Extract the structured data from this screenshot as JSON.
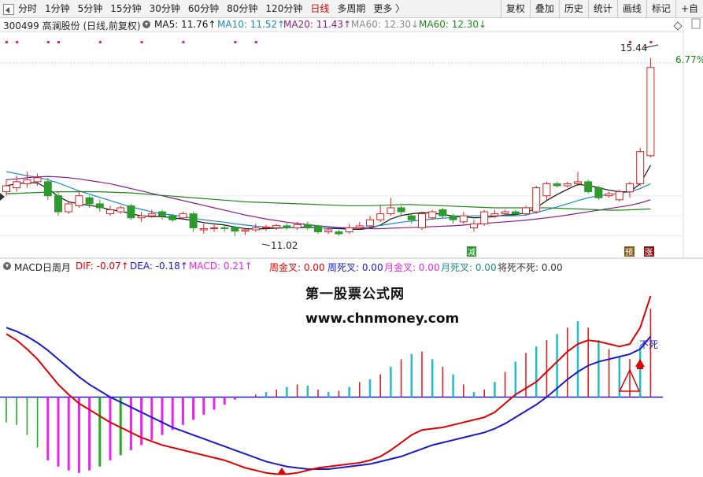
{
  "toolbar": {
    "tabs": [
      "分时",
      "1分钟",
      "5分钟",
      "15分钟",
      "30分钟",
      "60分钟",
      "80分钟",
      "120分钟",
      "日线",
      "多周期",
      "更多 〉"
    ],
    "active_tab": "日线",
    "right_buttons": [
      "复权",
      "叠加",
      "历史",
      "统计",
      "画线",
      "标记",
      "+自"
    ]
  },
  "info": {
    "code_name": "300499  高澜股份 (日线,前复权)",
    "ma5": "MA5: 11.76↑",
    "ma10": "MA10: 11.52↑",
    "ma20": "MA20: 11.43↑",
    "ma60a": "MA60: 12.30↓",
    "ma60b": "MA60: 12.30↓"
  },
  "macd_info": {
    "title": "MACD日周月",
    "dif": "DIF: -0.07↑",
    "dea": "DEA: -0.18↑",
    "macd": "MACD: 0.21↑",
    "zhou_jin": "周金叉: 0.00",
    "zhou_si": "周死叉: 0.00",
    "yue_jin": "月金叉: 0.00",
    "yue_si": "月死叉: 0.00",
    "jiang_si": "将死不死: 0.00"
  },
  "annotations": {
    "high": "15.44",
    "low": "11.02",
    "pct": "6.77%",
    "bu_si": "不死",
    "mark_jian": "减",
    "mark_yu": "预",
    "mark_zhang": "涨"
  },
  "watermark": {
    "line1": "第一股票公式网",
    "line2": "www.chnmoney.com"
  },
  "colors": {
    "up": "#e02020",
    "down": "#2e9a2e",
    "dif": "#e00000",
    "dea": "#1a1acc",
    "ma5": "#111111",
    "ma10": "#1a88d0",
    "ma20": "#8a1a8a",
    "ma60": "#1a8a1a",
    "hist_magenta": "#ee22ee",
    "hist_green": "#22aa22",
    "hist_cyan": "#22bbcc"
  },
  "chart_data": {
    "type": "candlestick",
    "price_range": [
      10.6,
      16.0
    ],
    "candles": [
      {
        "o": 12.1,
        "c": 12.25,
        "h": 12.4,
        "l": 12.0
      },
      {
        "o": 12.2,
        "c": 12.35,
        "h": 12.5,
        "l": 12.1
      },
      {
        "o": 12.3,
        "c": 12.4,
        "h": 12.6,
        "l": 12.2
      },
      {
        "o": 12.35,
        "c": 12.45,
        "h": 12.55,
        "l": 12.25
      },
      {
        "o": 12.35,
        "c": 12.0,
        "h": 12.45,
        "l": 11.9
      },
      {
        "o": 12.0,
        "c": 11.6,
        "h": 12.1,
        "l": 11.5
      },
      {
        "o": 11.6,
        "c": 11.8,
        "h": 11.85,
        "l": 11.55
      },
      {
        "o": 11.75,
        "c": 12.0,
        "h": 12.1,
        "l": 11.7
      },
      {
        "o": 11.95,
        "c": 11.8,
        "h": 12.0,
        "l": 11.7
      },
      {
        "o": 11.8,
        "c": 11.7,
        "h": 11.9,
        "l": 11.6
      },
      {
        "o": 11.55,
        "c": 11.65,
        "h": 11.75,
        "l": 11.5
      },
      {
        "o": 11.6,
        "c": 11.7,
        "h": 11.75,
        "l": 11.55
      },
      {
        "o": 11.75,
        "c": 11.45,
        "h": 11.8,
        "l": 11.4
      },
      {
        "o": 11.45,
        "c": 11.5,
        "h": 11.6,
        "l": 11.35
      },
      {
        "o": 11.5,
        "c": 11.55,
        "h": 11.65,
        "l": 11.45
      },
      {
        "o": 11.6,
        "c": 11.5,
        "h": 11.65,
        "l": 11.4
      },
      {
        "o": 11.5,
        "c": 11.4,
        "h": 11.55,
        "l": 11.35
      },
      {
        "o": 11.45,
        "c": 11.55,
        "h": 11.6,
        "l": 11.4
      },
      {
        "o": 11.55,
        "c": 11.2,
        "h": 11.6,
        "l": 11.1
      },
      {
        "o": 11.15,
        "c": 11.18,
        "h": 11.3,
        "l": 11.05
      },
      {
        "o": 11.18,
        "c": 11.2,
        "h": 11.3,
        "l": 11.1
      },
      {
        "o": 11.2,
        "c": 11.18,
        "h": 11.25,
        "l": 11.1
      },
      {
        "o": 11.22,
        "c": 11.12,
        "h": 11.25,
        "l": 11.0
      },
      {
        "o": 11.12,
        "c": 11.15,
        "h": 11.2,
        "l": 11.02
      },
      {
        "o": 11.15,
        "c": 11.2,
        "h": 11.3,
        "l": 11.1
      },
      {
        "o": 11.2,
        "c": 11.22,
        "h": 11.28,
        "l": 11.12
      },
      {
        "o": 11.2,
        "c": 11.26,
        "h": 11.3,
        "l": 11.15
      },
      {
        "o": 11.25,
        "c": 11.2,
        "h": 11.32,
        "l": 11.15
      },
      {
        "o": 11.2,
        "c": 11.28,
        "h": 11.35,
        "l": 11.15
      },
      {
        "o": 11.28,
        "c": 11.2,
        "h": 11.35,
        "l": 11.15
      },
      {
        "o": 11.25,
        "c": 11.1,
        "h": 11.28,
        "l": 11.05
      },
      {
        "o": 11.1,
        "c": 11.15,
        "h": 11.2,
        "l": 11.05
      },
      {
        "o": 11.1,
        "c": 11.05,
        "h": 11.15,
        "l": 11.0
      },
      {
        "o": 11.1,
        "c": 11.2,
        "h": 11.3,
        "l": 11.05
      },
      {
        "o": 11.2,
        "c": 11.25,
        "h": 11.35,
        "l": 11.15
      },
      {
        "o": 11.25,
        "c": 11.4,
        "h": 11.5,
        "l": 11.2
      },
      {
        "o": 11.4,
        "c": 11.55,
        "h": 11.75,
        "l": 11.35
      },
      {
        "o": 11.55,
        "c": 11.7,
        "h": 11.95,
        "l": 11.5
      },
      {
        "o": 11.7,
        "c": 11.6,
        "h": 11.75,
        "l": 11.5
      },
      {
        "o": 11.5,
        "c": 11.4,
        "h": 11.55,
        "l": 11.3
      },
      {
        "o": 11.2,
        "c": 11.55,
        "h": 11.6,
        "l": 11.15
      },
      {
        "o": 11.45,
        "c": 11.6,
        "h": 11.65,
        "l": 11.4
      },
      {
        "o": 11.65,
        "c": 11.5,
        "h": 11.7,
        "l": 11.45
      },
      {
        "o": 11.5,
        "c": 11.4,
        "h": 11.55,
        "l": 11.3
      },
      {
        "o": 11.35,
        "c": 11.5,
        "h": 11.6,
        "l": 11.3
      },
      {
        "o": 11.2,
        "c": 11.3,
        "h": 11.4,
        "l": 11.1
      },
      {
        "o": 11.3,
        "c": 11.6,
        "h": 11.65,
        "l": 11.25
      },
      {
        "o": 11.5,
        "c": 11.55,
        "h": 11.65,
        "l": 11.45
      },
      {
        "o": 11.55,
        "c": 11.6,
        "h": 11.65,
        "l": 11.5
      },
      {
        "o": 11.6,
        "c": 11.55,
        "h": 11.65,
        "l": 11.5
      },
      {
        "o": 11.55,
        "c": 11.7,
        "h": 11.75,
        "l": 11.5
      },
      {
        "o": 11.6,
        "c": 12.2,
        "h": 12.25,
        "l": 11.55
      },
      {
        "o": 12.0,
        "c": 12.3,
        "h": 12.35,
        "l": 11.9
      },
      {
        "o": 12.3,
        "c": 12.25,
        "h": 12.35,
        "l": 12.2
      },
      {
        "o": 12.25,
        "c": 12.3,
        "h": 12.35,
        "l": 12.2
      },
      {
        "o": 12.3,
        "c": 12.35,
        "h": 12.6,
        "l": 12.25
      },
      {
        "o": 12.35,
        "c": 12.1,
        "h": 12.4,
        "l": 12.05
      },
      {
        "o": 12.2,
        "c": 11.95,
        "h": 12.25,
        "l": 11.9
      },
      {
        "o": 12.0,
        "c": 12.05,
        "h": 12.1,
        "l": 11.95
      },
      {
        "o": 11.9,
        "c": 12.1,
        "h": 12.15,
        "l": 11.85
      },
      {
        "o": 12.1,
        "c": 12.3,
        "h": 12.35,
        "l": 11.95
      },
      {
        "o": 12.3,
        "c": 13.1,
        "h": 13.2,
        "l": 12.25
      },
      {
        "o": 13.0,
        "c": 15.2,
        "h": 15.44,
        "l": 12.95
      }
    ],
    "ma5": [
      12.25,
      12.3,
      12.33,
      12.32,
      12.18,
      11.98,
      11.85,
      11.8,
      11.76,
      11.72,
      11.65,
      11.62,
      11.55,
      11.5,
      11.48,
      11.48,
      11.45,
      11.42,
      11.38,
      11.33,
      11.3,
      11.27,
      11.22,
      11.18,
      11.17,
      11.18,
      11.19,
      11.2,
      11.21,
      11.22,
      11.2,
      11.19,
      11.18,
      11.17,
      11.16,
      11.19,
      11.27,
      11.42,
      11.51,
      11.55,
      11.58,
      11.57,
      11.53,
      11.5,
      11.48,
      11.45,
      11.46,
      11.48,
      11.52,
      11.53,
      11.57,
      11.7,
      11.88,
      12.03,
      12.16,
      12.28,
      12.26,
      12.2,
      12.14,
      12.1,
      12.1,
      12.3,
      12.76
    ],
    "ma10": [
      12.6,
      12.55,
      12.5,
      12.46,
      12.4,
      12.32,
      12.22,
      12.12,
      12.04,
      11.96,
      11.88,
      11.8,
      11.72,
      11.66,
      11.6,
      11.55,
      11.52,
      11.48,
      11.44,
      11.4,
      11.37,
      11.34,
      11.3,
      11.27,
      11.24,
      11.22,
      11.21,
      11.2,
      11.2,
      11.2,
      11.2,
      11.2,
      11.2,
      11.2,
      11.2,
      11.22,
      11.26,
      11.3,
      11.34,
      11.37,
      11.39,
      11.42,
      11.44,
      11.46,
      11.48,
      11.5,
      11.5,
      11.5,
      11.5,
      11.5,
      11.52,
      11.58,
      11.65,
      11.72,
      11.8,
      11.88,
      11.95,
      12.0,
      12.03,
      12.06,
      12.1,
      12.18,
      12.3
    ],
    "ma20": [
      12.4,
      12.42,
      12.45,
      12.47,
      12.48,
      12.47,
      12.45,
      12.42,
      12.38,
      12.34,
      12.3,
      12.24,
      12.18,
      12.12,
      12.06,
      12.0,
      11.94,
      11.88,
      11.82,
      11.76,
      11.7,
      11.64,
      11.58,
      11.52,
      11.47,
      11.42,
      11.38,
      11.34,
      11.31,
      11.28,
      11.25,
      11.23,
      11.21,
      11.2,
      11.19,
      11.18,
      11.18,
      11.19,
      11.2,
      11.21,
      11.22,
      11.23,
      11.24,
      11.25,
      11.27,
      11.29,
      11.31,
      11.33,
      11.35,
      11.37,
      11.39,
      11.42,
      11.45,
      11.48,
      11.52,
      11.56,
      11.6,
      11.64,
      11.68,
      11.72,
      11.76,
      11.82,
      11.9
    ],
    "ma60": [
      12.05,
      12.06,
      12.07,
      12.08,
      12.09,
      12.1,
      12.1,
      12.1,
      12.1,
      12.1,
      12.09,
      12.08,
      12.07,
      12.05,
      12.03,
      12.01,
      11.99,
      11.97,
      11.95,
      11.93,
      11.91,
      11.89,
      11.87,
      11.85,
      11.84,
      11.83,
      11.82,
      11.81,
      11.8,
      11.79,
      11.78,
      11.77,
      11.76,
      11.75,
      11.75,
      11.75,
      11.76,
      11.77,
      11.78,
      11.78,
      11.77,
      11.76,
      11.75,
      11.74,
      11.73,
      11.72,
      11.71,
      11.7,
      11.7,
      11.7,
      11.7,
      11.7,
      11.7,
      11.69,
      11.68,
      11.67,
      11.66,
      11.65,
      11.64,
      11.64,
      11.65,
      11.66,
      11.67
    ],
    "macd_range": [
      -0.62,
      0.95
    ],
    "dif": [
      0.5,
      0.45,
      0.38,
      0.3,
      0.2,
      0.1,
      0.02,
      -0.05,
      -0.1,
      -0.15,
      -0.2,
      -0.24,
      -0.28,
      -0.32,
      -0.35,
      -0.38,
      -0.4,
      -0.42,
      -0.44,
      -0.46,
      -0.48,
      -0.5,
      -0.53,
      -0.56,
      -0.58,
      -0.6,
      -0.61,
      -0.61,
      -0.6,
      -0.58,
      -0.56,
      -0.55,
      -0.54,
      -0.53,
      -0.52,
      -0.5,
      -0.47,
      -0.42,
      -0.36,
      -0.3,
      -0.26,
      -0.25,
      -0.24,
      -0.22,
      -0.2,
      -0.18,
      -0.16,
      -0.12,
      -0.05,
      0.02,
      0.07,
      0.12,
      0.2,
      0.28,
      0.36,
      0.42,
      0.45,
      0.44,
      0.42,
      0.4,
      0.42,
      0.55,
      0.8
    ],
    "dea": [
      0.55,
      0.52,
      0.48,
      0.43,
      0.37,
      0.3,
      0.23,
      0.16,
      0.1,
      0.05,
      0.0,
      -0.04,
      -0.08,
      -0.12,
      -0.16,
      -0.2,
      -0.24,
      -0.27,
      -0.3,
      -0.33,
      -0.36,
      -0.39,
      -0.42,
      -0.45,
      -0.48,
      -0.51,
      -0.53,
      -0.55,
      -0.56,
      -0.57,
      -0.57,
      -0.57,
      -0.56,
      -0.55,
      -0.54,
      -0.53,
      -0.51,
      -0.49,
      -0.47,
      -0.44,
      -0.41,
      -0.38,
      -0.36,
      -0.34,
      -0.32,
      -0.3,
      -0.28,
      -0.25,
      -0.21,
      -0.16,
      -0.11,
      -0.06,
      0.0,
      0.07,
      0.14,
      0.2,
      0.25,
      0.28,
      0.3,
      0.32,
      0.34,
      0.38,
      0.48
    ],
    "hist": [
      -0.2,
      -0.22,
      -0.3,
      -0.4,
      -0.5,
      -0.55,
      -0.58,
      -0.6,
      -0.58,
      -0.55,
      -0.5,
      -0.46,
      -0.42,
      -0.38,
      -0.34,
      -0.3,
      -0.26,
      -0.22,
      -0.18,
      -0.14,
      -0.1,
      -0.06,
      -0.02,
      0.0,
      0.02,
      0.04,
      0.06,
      0.08,
      0.1,
      0.09,
      0.06,
      0.04,
      0.05,
      0.08,
      0.12,
      0.14,
      0.18,
      0.24,
      0.3,
      0.34,
      0.36,
      0.3,
      0.24,
      0.18,
      0.1,
      0.04,
      0.06,
      0.12,
      0.2,
      0.28,
      0.35,
      0.4,
      0.45,
      0.5,
      0.55,
      0.6,
      0.55,
      0.45,
      0.38,
      0.32,
      0.3,
      0.4,
      0.7
    ]
  }
}
